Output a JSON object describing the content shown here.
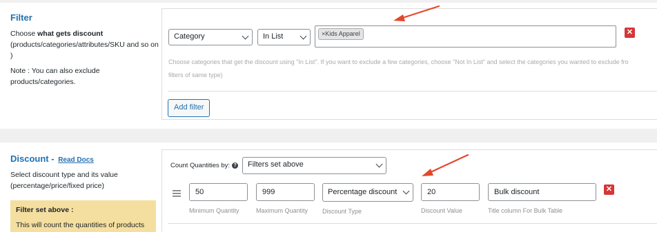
{
  "filter": {
    "title": "Filter",
    "desc_pre": "Choose ",
    "desc_bold": "what gets discount",
    "desc_post": " (products/categories/attributes/SKU and so on )",
    "note": "Note : You can also exclude products/categories.",
    "type_select": "Category",
    "method_select": "In List",
    "selected_tag": "Kids Apparel",
    "tag_remove": "×",
    "hint_line1": "Choose categories that get the discount using \"In List\". If you want to exclude a few categories, choose \"Not In List\" and select the categories you wanted to exclude fro",
    "hint_line2": "filters of same type)",
    "remove_button": "✕",
    "add_filter_label": "Add filter"
  },
  "discount": {
    "title": "Discount",
    "dash": " - ",
    "read_docs": "Read Docs",
    "desc": "Select discount type and its value (percentage/price/fixed price)",
    "box_title": "Filter set above :",
    "box_text": "This will count the quantities of products",
    "count_label": "Count Quantities by:",
    "info_icon": "?",
    "count_select": "Filters set above",
    "min_qty": "50",
    "max_qty": "999",
    "discount_type": "Percentage discount",
    "discount_value": "20",
    "title_column": "Bulk discount",
    "cap_min": "Minimum Quantity",
    "cap_max": "Maximum Quantity",
    "cap_type": "Discount Type",
    "cap_value": "Discount Value",
    "cap_title": "Title column For Bulk Table",
    "remove_button": "✕"
  },
  "colors": {
    "accent": "#2271b1",
    "danger": "#d63638",
    "arrow": "#e4472b",
    "note_box": "#f5dfa0"
  }
}
